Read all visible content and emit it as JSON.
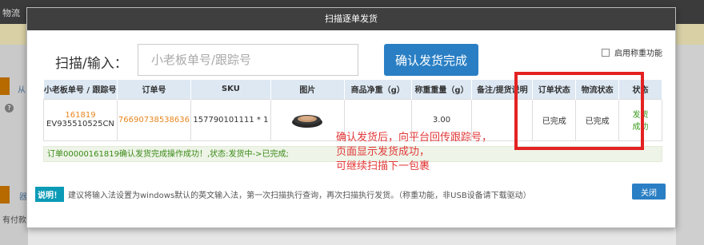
{
  "background": {
    "topbar_text": "物流",
    "left_text_1": "从",
    "left_text_2": "器",
    "left_text_3": "有付款"
  },
  "modal": {
    "title": "扫描逐单发货",
    "scan_label": "扫描/输入：",
    "scan_placeholder": "小老板单号/跟踪号",
    "confirm_button": "确认发货完成",
    "weigh_label": "启用称重功能",
    "table": {
      "headers": [
        "小老板单号 / 跟踪号",
        "订单号",
        "SKU",
        "图片",
        "商品净重（g）",
        "称重重量（g）",
        "备注/提货说明",
        "订单状态",
        "物流状态",
        "状态"
      ],
      "row": {
        "xlb_no": "161819",
        "tracking_no": "EV935510525CN",
        "order_no": "76690738538636",
        "sku": "157790101111 * 1",
        "net_weight": "",
        "weighed": "3.00",
        "remark": "",
        "order_status": "已完成",
        "logistics_status": "已完成",
        "status_line1": "发货",
        "status_line2": "成功"
      }
    },
    "result_message": "订单00000161819确认发货完成操作成功！,状态:发货中->已完成;",
    "note_tag": "说明！",
    "note_text": "建议将输入法设置为windows默认的英文输入法，第一次扫描执行查询，再次扫描执行发货。（称重功能，非USB设备请下载驱动）",
    "close_button": "关闭"
  },
  "annotation": {
    "line1": "确认发货后，向平台回传跟踪号，",
    "line2": "页面显示发货成功，",
    "line3": "可继续扫描下一包裹"
  },
  "colors": {
    "primary_button": "#2a7fc4",
    "highlight_red": "#e32222",
    "order_link": "#e8861f",
    "success_green": "#3a9a1c"
  }
}
